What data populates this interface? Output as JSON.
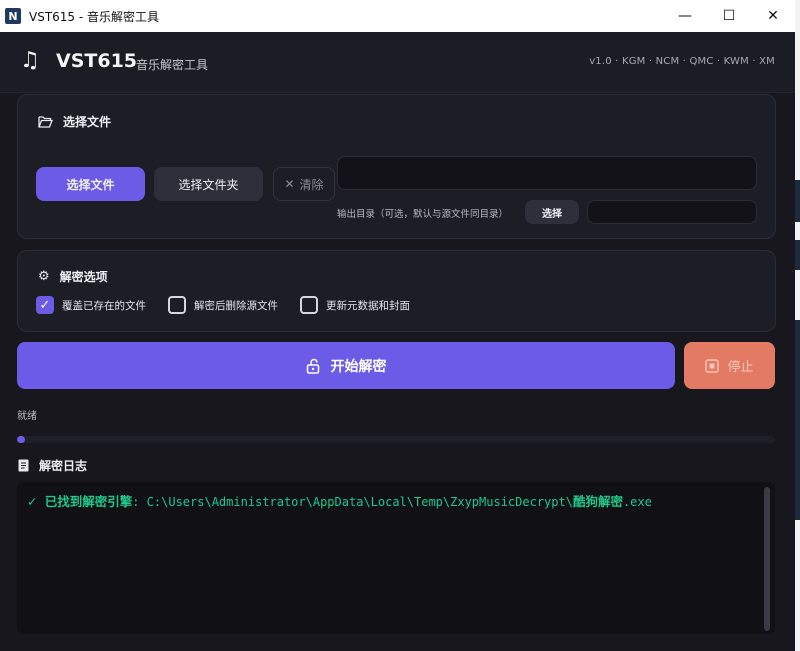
{
  "titlebar": {
    "icon_letter": "N",
    "title": "VST615 - 音乐解密工具",
    "minimize": "—",
    "maximize": "☐",
    "close": "✕"
  },
  "header": {
    "app_name": "VST615",
    "subtitle": "音乐解密工具",
    "version": "v1.0 · KGM · NCM · QMC · KWM · XM"
  },
  "file_card": {
    "title": "选择文件",
    "select_file": "选择文件",
    "select_folder": "选择文件夹",
    "clear": "清除",
    "file_input_value": "",
    "output_hint": "输出目录（可选，默认与源文件同目录）",
    "output_select": "选择",
    "output_input_value": ""
  },
  "options_card": {
    "title": "解密选项",
    "options": [
      {
        "label": "覆盖已存在的文件",
        "checked": true
      },
      {
        "label": "解密后删除源文件",
        "checked": false
      },
      {
        "label": "更新元数据和封面",
        "checked": false
      }
    ]
  },
  "actions": {
    "start": "开始解密",
    "stop": "停止"
  },
  "status": {
    "text": "就绪",
    "progress": 0.01
  },
  "log": {
    "title": "解密日志",
    "check": "✓",
    "prefix": "已找到解密引擎",
    "path_part1": ": C:\\Users\\Administrator\\AppData\\Local\\Temp\\ZxypMusicDecrypt\\",
    "path_bold": "酷狗解密",
    "path_ext": ".exe"
  },
  "colors": {
    "accent": "#6c5be6",
    "stop": "#e27a64",
    "log_text": "#1ec98a",
    "background": "#17171d"
  },
  "icons": {
    "music": "music-note-icon",
    "folder": "folder-open-icon",
    "settings": "gear-icon",
    "unlock": "unlock-icon",
    "stop": "stop-icon",
    "log": "document-icon"
  }
}
